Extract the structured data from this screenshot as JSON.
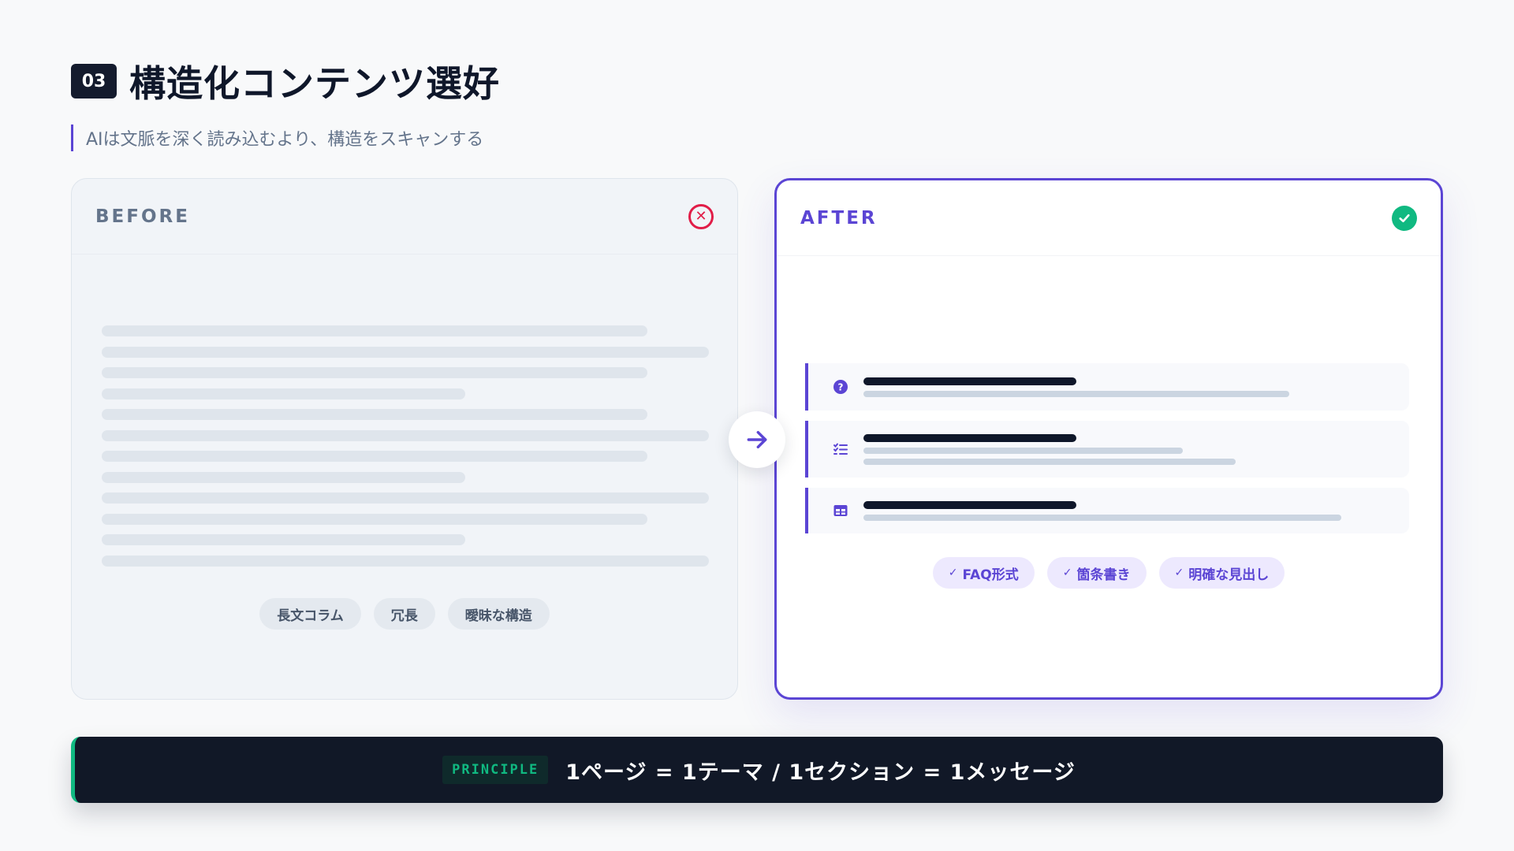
{
  "header": {
    "number": "03",
    "title": "構造化コンテンツ選好",
    "subtitle": "AIは文脈を深く読み込むより、構造をスキャンする"
  },
  "before": {
    "label": "BEFORE",
    "status_icon": "x-circle-icon",
    "tags": [
      "長文コラム",
      "冗長",
      "曖昧な構造"
    ]
  },
  "after": {
    "label": "AFTER",
    "status_icon": "check-circle-icon",
    "blocks": [
      {
        "icon": "question-circle-icon"
      },
      {
        "icon": "checklist-icon"
      },
      {
        "icon": "table-icon"
      }
    ],
    "tags": [
      "FAQ形式",
      "箇条書き",
      "明確な見出し"
    ]
  },
  "transition_icon": "arrow-right-icon",
  "principle": {
    "label": "PRINCIPLE",
    "text": "1ページ = 1テーマ / 1セクション = 1メッセージ"
  },
  "colors": {
    "accent": "#5b45d4",
    "success": "#10b981",
    "error": "#e11d48",
    "dark": "#111827"
  }
}
